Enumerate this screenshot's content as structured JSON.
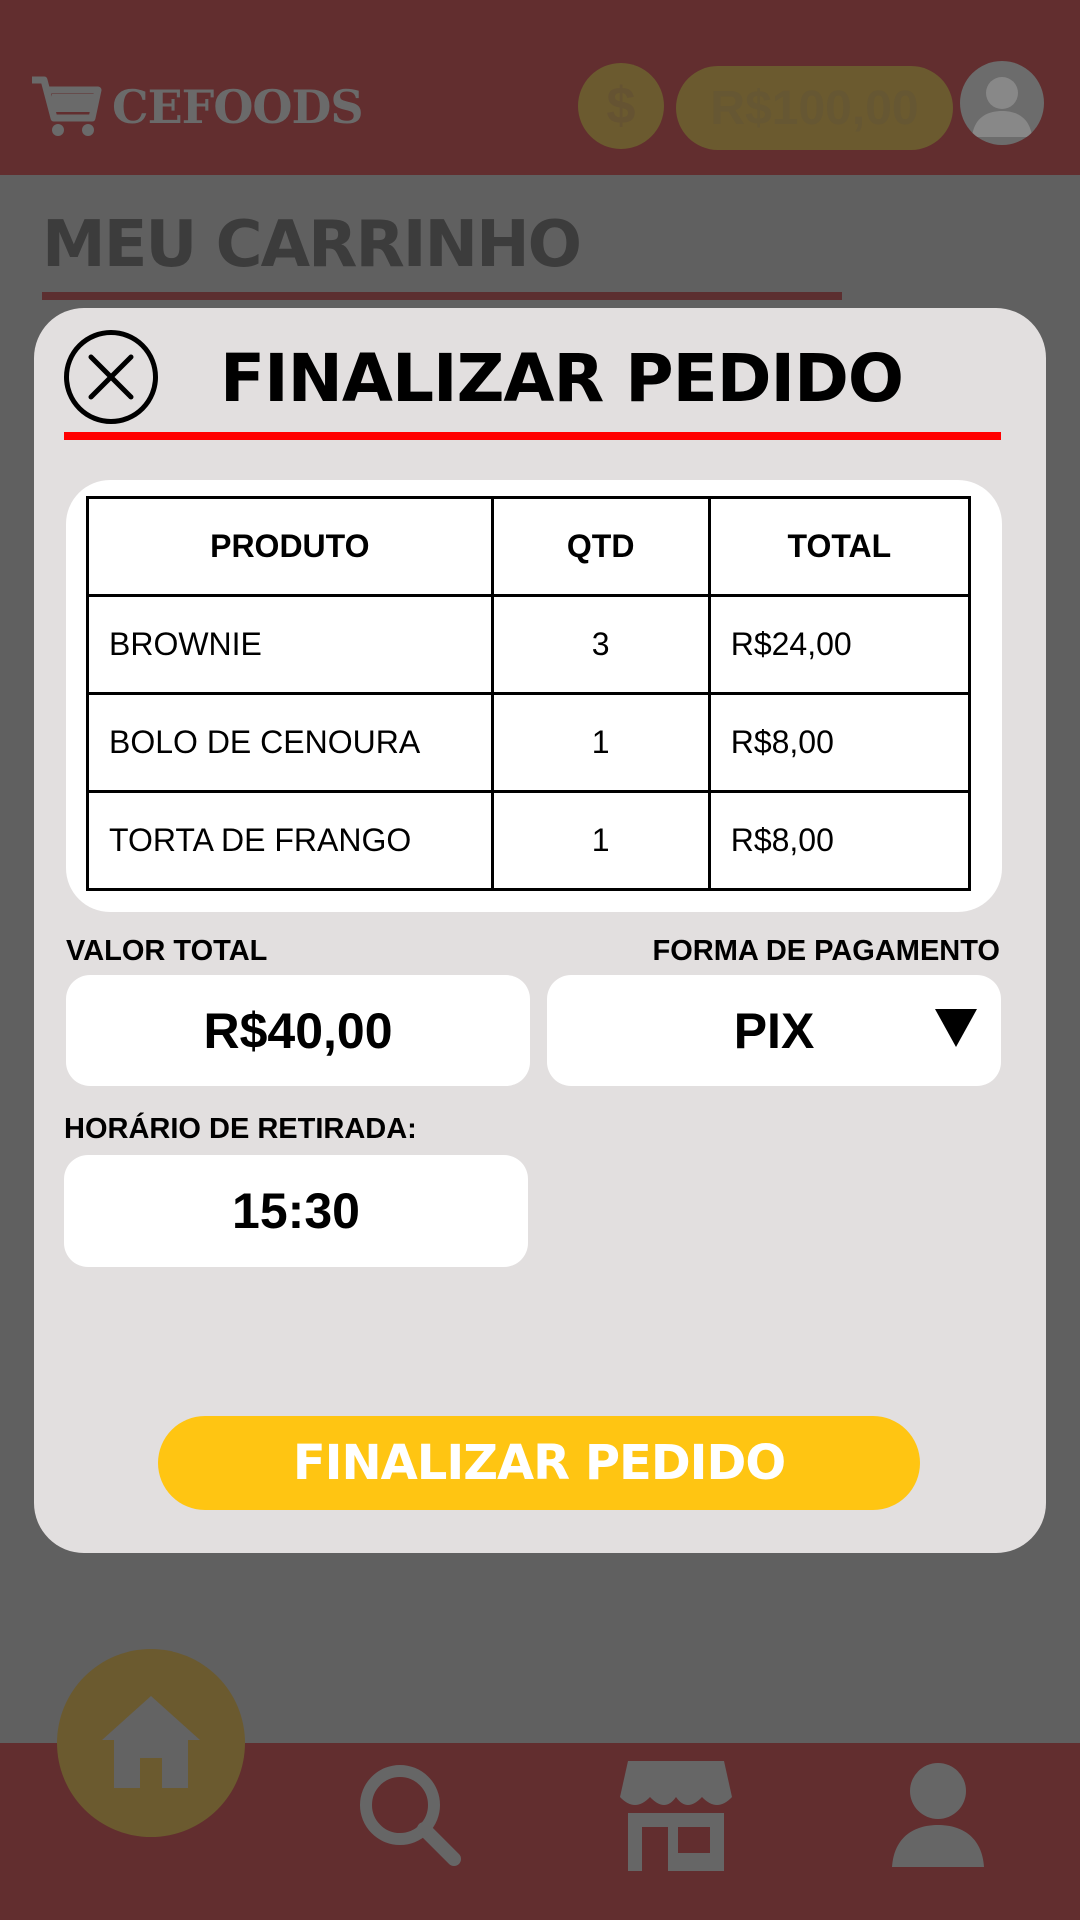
{
  "app": {
    "brand": "CEFOODS",
    "page_title": "MEU CARRINHO"
  },
  "header": {
    "coin_symbol": "$",
    "balance": "R$100,00"
  },
  "modal": {
    "title": "FINALIZAR PEDIDO",
    "table": {
      "headers": [
        "PRODUTO",
        "QTD",
        "TOTAL"
      ],
      "rows": [
        {
          "produto": "BROWNIE",
          "qtd": "3",
          "total": "R$24,00"
        },
        {
          "produto": "BOLO DE CENOURA",
          "qtd": "1",
          "total": "R$8,00"
        },
        {
          "produto": "TORTA DE FRANGO",
          "qtd": "1",
          "total": "R$8,00"
        }
      ]
    },
    "valor_total_label": "VALOR TOTAL",
    "valor_total": "R$40,00",
    "pagamento_label": "FORMA DE PAGAMENTO",
    "pagamento_selected": "PIX",
    "horario_label": "HORÁRIO DE RETIRADA:",
    "horario": "15:30",
    "submit_label": "FINALIZAR PEDIDO"
  },
  "nav": {
    "items": [
      "home-icon",
      "search-icon",
      "store-icon",
      "profile-icon"
    ]
  },
  "colors": {
    "bar": "#622e2f",
    "overlay": "#606060",
    "accent_red": "#ff0000",
    "button_yellow": "#ffc512",
    "modal_bg": "#e2dfdf"
  }
}
